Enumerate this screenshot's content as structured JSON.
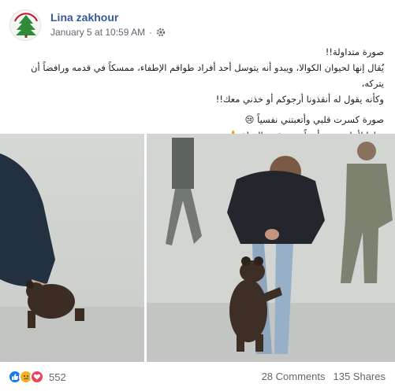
{
  "post": {
    "author": "Lina zakhour",
    "timestamp": "January 5 at 10:59 AM",
    "separator": "·",
    "audience_icon": "gear-icon",
    "more_label": "···",
    "text_lines": [
      "صورة متداولة!!",
      "يُقال إنها لحيوان الكوالا، ويبدو أنه يتوسل أحد أفراد طواقم الإطفاء، ممسكاً في قدمه ورافضاً أن يتركه،",
      "وكأنه يقول له أنقذونا أرجوكم أو خذني معك!!",
      "صورة كسرت قلبي وأتعبتني نفسياً 😢",
      "صلوا لأجلهم، هم أيضاً يستحقون الحياة 🙏"
    ]
  },
  "reactions": {
    "icons": [
      "like-icon",
      "sad-icon",
      "love-icon"
    ],
    "count": "552"
  },
  "stats": {
    "comments": "28 Comments",
    "shares": "135 Shares"
  },
  "colors": {
    "author": "#385898",
    "meta": "#616770",
    "like": "#1877f2",
    "sad": "#f7b125",
    "love": "#f33e58"
  }
}
